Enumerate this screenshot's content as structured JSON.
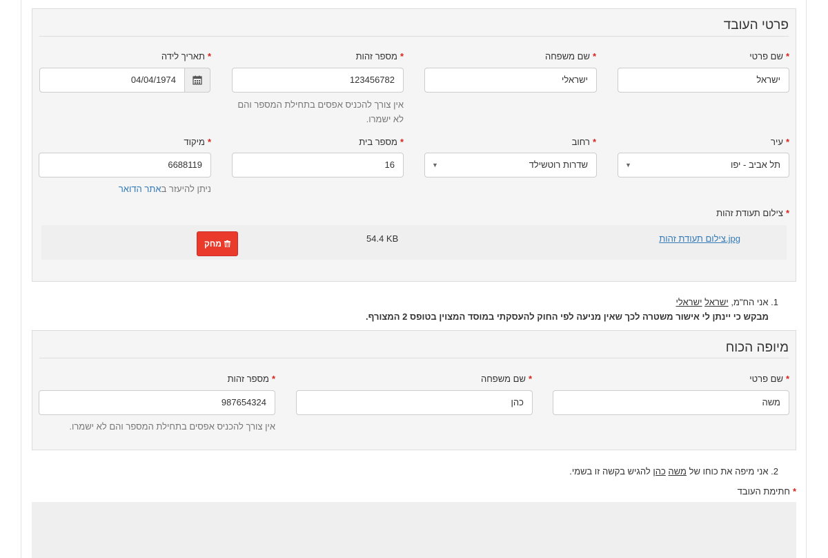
{
  "employee": {
    "title": "פרטי העובד",
    "first_name": {
      "label": "שם פרטי",
      "value": "ישראל"
    },
    "last_name": {
      "label": "שם משפחה",
      "value": "ישראלי"
    },
    "id_number": {
      "label": "מספר זהות",
      "value": "123456782",
      "help": "אין צורך להכניס אפסים בתחילת המספר והם לא ישמרו."
    },
    "birth_date": {
      "label": "תאריך לידה",
      "value": "04/04/1974"
    },
    "city": {
      "label": "עיר",
      "value": "תל אביב - יפו"
    },
    "street": {
      "label": "רחוב",
      "value": "שדרות רוטשילד"
    },
    "house_number": {
      "label": "מספר בית",
      "value": "16"
    },
    "zip": {
      "label": "מיקוד",
      "value": "6688119",
      "help_prefix": "ניתן להיעזר ב",
      "help_link": "אתר הדואר"
    },
    "id_photo": {
      "label": "צילום תעודת זהות",
      "file_name": "צילום תעודת זהות.jpg",
      "file_size": "54.4 KB",
      "delete_label": "מחק"
    }
  },
  "statement1": {
    "number": "1.",
    "text_prefix": "אני הח\"מ,",
    "first_name": "ישראל",
    "last_name": "ישראלי",
    "bold_text": "מבקש כי יינתן לי אישור משטרה לכך שאין מניעה לפי החוק להעסקתי במוסד המצוין בטופס 2 המצורף."
  },
  "attorney": {
    "title": "מיופה הכוח",
    "first_name": {
      "label": "שם פרטי",
      "value": "משה"
    },
    "last_name": {
      "label": "שם משפחה",
      "value": "כהן"
    },
    "id_number": {
      "label": "מספר זהות",
      "value": "987654324",
      "help": "אין צורך להכניס אפסים בתחילת המספר והם לא ישמרו."
    }
  },
  "statement2": {
    "number": "2.",
    "text_prefix": "אני מיפה את כוחו של",
    "first_name": "משה",
    "last_name": "כהן",
    "text_suffix": "להגיש בקשה זו בשמי."
  },
  "signature": {
    "label": "חתימת העובד"
  },
  "required_mark": "*",
  "colors": {
    "required": "#d9231d",
    "delete_button": "#ea3a2c",
    "link": "#337ab7",
    "panel_bg": "#f5f5f5"
  }
}
